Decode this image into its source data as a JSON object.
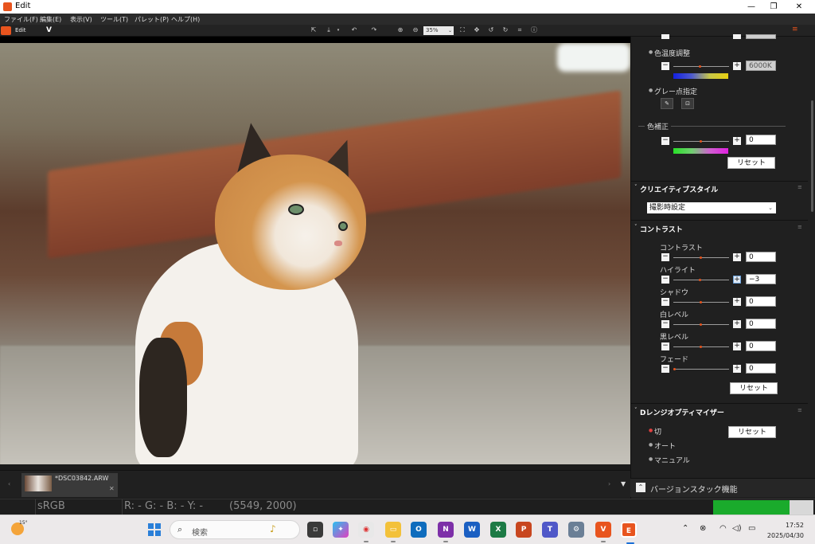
{
  "window": {
    "title": "Edit",
    "minimize": "—",
    "maximize": "❐",
    "close": "✕"
  },
  "menu": [
    "ファイル(F)",
    "編集(E)",
    "表示(V)",
    "ツール(T)",
    "パレット(P)",
    "ヘルプ(H)"
  ],
  "toolbar": {
    "edit_label": "Edit",
    "brand": "V",
    "zoom": "35%",
    "zoom_dropdown": "⌄",
    "panel_menu": "≡"
  },
  "panel": {
    "color_temp": {
      "label": "色温度調整",
      "value": "6000K",
      "minus": "−",
      "plus": "+"
    },
    "gray_point": {
      "label": "グレー点指定"
    },
    "color_correction": {
      "label": "色補正",
      "value": "0",
      "reset": "リセット",
      "minus": "−",
      "plus": "+"
    },
    "creative_style": {
      "header": "クリエイティブスタイル",
      "selected": "撮影時設定"
    },
    "contrast": {
      "header": "コントラスト",
      "rows": [
        {
          "label": "コントラスト",
          "value": "0",
          "level": 0.5
        },
        {
          "label": "ハイライト",
          "value": "−3",
          "level": 0.48
        },
        {
          "label": "シャドウ",
          "value": "0",
          "level": 0.5
        },
        {
          "label": "白レベル",
          "value": "0",
          "level": 0.5
        },
        {
          "label": "黒レベル",
          "value": "0",
          "level": 0.5
        },
        {
          "label": "フェード",
          "value": "0",
          "level": 0.0
        }
      ],
      "reset": "リセット"
    },
    "d_range": {
      "header": "Dレンジオプティマイザー",
      "options": [
        "切",
        "オート",
        "マニュアル"
      ],
      "selected": "切",
      "reset": "リセット"
    },
    "version_stack": "バージョンスタック機能"
  },
  "filmstrip": {
    "file_name": "*DSC03842.ARW",
    "close": "✕"
  },
  "status": {
    "color_space": "sRGB",
    "rgb_readout": "R: -   G: -   B: -   Y: -",
    "coords": "(5549, 2000)",
    "progress": 0.76
  },
  "taskbar": {
    "temperature": "15°",
    "search_placeholder": "検索",
    "time": "17:52",
    "date": "2025/04/30"
  },
  "colors": {
    "accent": "#e8541e",
    "progress": "#1aab2c",
    "panel_bg": "#202020"
  }
}
